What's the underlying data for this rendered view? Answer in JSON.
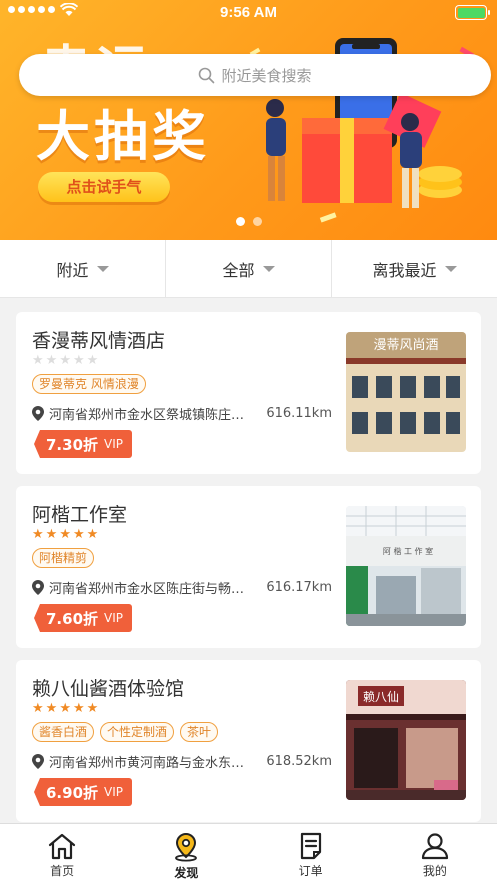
{
  "status_bar": {
    "time": "9:56 AM"
  },
  "banner": {
    "headline_top": "幸运",
    "headline_main": "大抽奖",
    "cta": "点击试手气",
    "colors": {
      "primary": "#ff9a1a",
      "accent": "#ffc21a"
    }
  },
  "search": {
    "placeholder": "附近美食搜索",
    "icon": "search-icon"
  },
  "filters": [
    {
      "label": "附近"
    },
    {
      "label": "全部"
    },
    {
      "label": "离我最近"
    }
  ],
  "shops": [
    {
      "name": "香漫蒂风情酒店",
      "rating": 0,
      "tags": [
        "罗曼蒂克 风情浪漫"
      ],
      "address": "河南省郑州市金水区祭城镇陈庄…",
      "distance": "616.11km",
      "discount": "7.30折",
      "vip": "VIP",
      "photo_sign": "漫蒂风尚酒"
    },
    {
      "name": "阿楷工作室",
      "rating": 5,
      "tags": [
        "阿楷精剪"
      ],
      "address": "河南省郑州市金水区陈庄街与畅…",
      "distance": "616.17km",
      "discount": "7.60折",
      "vip": "VIP",
      "photo_sign": "阿 楷 工 作 室"
    },
    {
      "name": "赖八仙酱酒体验馆",
      "rating": 5,
      "tags": [
        "酱香白酒",
        "个性定制酒",
        "茶叶"
      ],
      "address": "河南省郑州市黄河南路与金水东…",
      "distance": "618.52km",
      "discount": "6.90折",
      "vip": "VIP",
      "photo_sign": "赖八仙"
    }
  ],
  "tabbar": [
    {
      "label": "首页",
      "icon": "home-icon",
      "active": false
    },
    {
      "label": "发现",
      "icon": "location-pin-icon",
      "active": true
    },
    {
      "label": "订单",
      "icon": "order-list-icon",
      "active": false
    },
    {
      "label": "我的",
      "icon": "user-icon",
      "active": false
    }
  ],
  "colors": {
    "accent": "#f08a24",
    "discount": "#f0603a",
    "star_off": "#dddddd"
  }
}
